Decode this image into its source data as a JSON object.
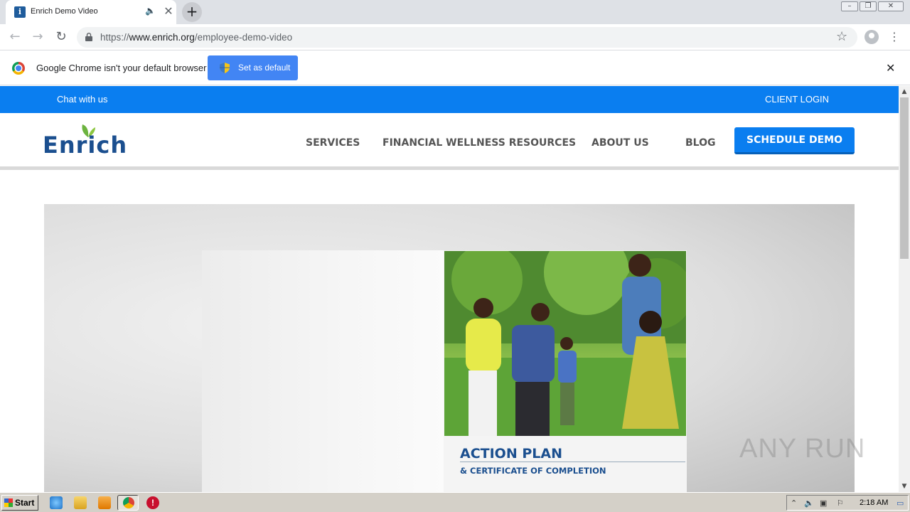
{
  "browser": {
    "tab": {
      "title": "Enrich Demo Video",
      "favicon": "enrich-favicon"
    },
    "address": {
      "scheme": "https://",
      "host": "www.enrich.org",
      "path": "/employee-demo-video"
    },
    "infobar": {
      "message": "Google Chrome isn't your default browser",
      "button_label": "Set as default"
    }
  },
  "site": {
    "topbar": {
      "chat_label": "Chat with us",
      "login_label": "CLIENT LOGIN"
    },
    "logo_text": "Enrich",
    "nav": [
      "SERVICES",
      "FINANCIAL WELLNESS RESOURCES",
      "ABOUT US",
      "BLOG"
    ],
    "cta_label": "SCHEDULE DEMO",
    "video": {
      "title": "ACTION PLAN",
      "subtitle": "& CERTIFICATE OF COMPLETION"
    }
  },
  "watermark": "ANY RUN",
  "taskbar": {
    "start_label": "Start",
    "clock": "2:18 AM"
  },
  "colors": {
    "brand_blue": "#0a7ef0",
    "logo_blue": "#1b4f8f",
    "leaf_green": "#6cb33f"
  }
}
